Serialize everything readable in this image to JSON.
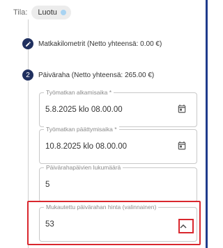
{
  "status": {
    "label": "Tila:",
    "value": "Luotu",
    "dot_color": "#a8d3f2"
  },
  "steps": [
    {
      "number": "",
      "icon": "pencil-icon",
      "title": "Matkakilometrit (Netto yhteensä: 0.00 €)"
    },
    {
      "number": "2",
      "title": "Päiväraha (Netto yhteensä: 265.00 €)"
    }
  ],
  "fields": {
    "start": {
      "label": "Työmatkan alkamisaika *",
      "value": "5.8.2025 klo 08.00.00",
      "icon": "calendar-icon"
    },
    "end": {
      "label": "Työmatkan päättymisaika *",
      "value": "10.8.2025 klo 08.00.00",
      "icon": "calendar-icon"
    },
    "days": {
      "label": "Päivärahapäivien lukumäärä",
      "value": "5"
    },
    "custom_price": {
      "label": "Mukautettu päivärahan hinta (valinnainen)",
      "value": "53",
      "icon": "chevron-up-icon"
    }
  },
  "colors": {
    "accent": "#20305f",
    "highlight": "#d9272e"
  }
}
